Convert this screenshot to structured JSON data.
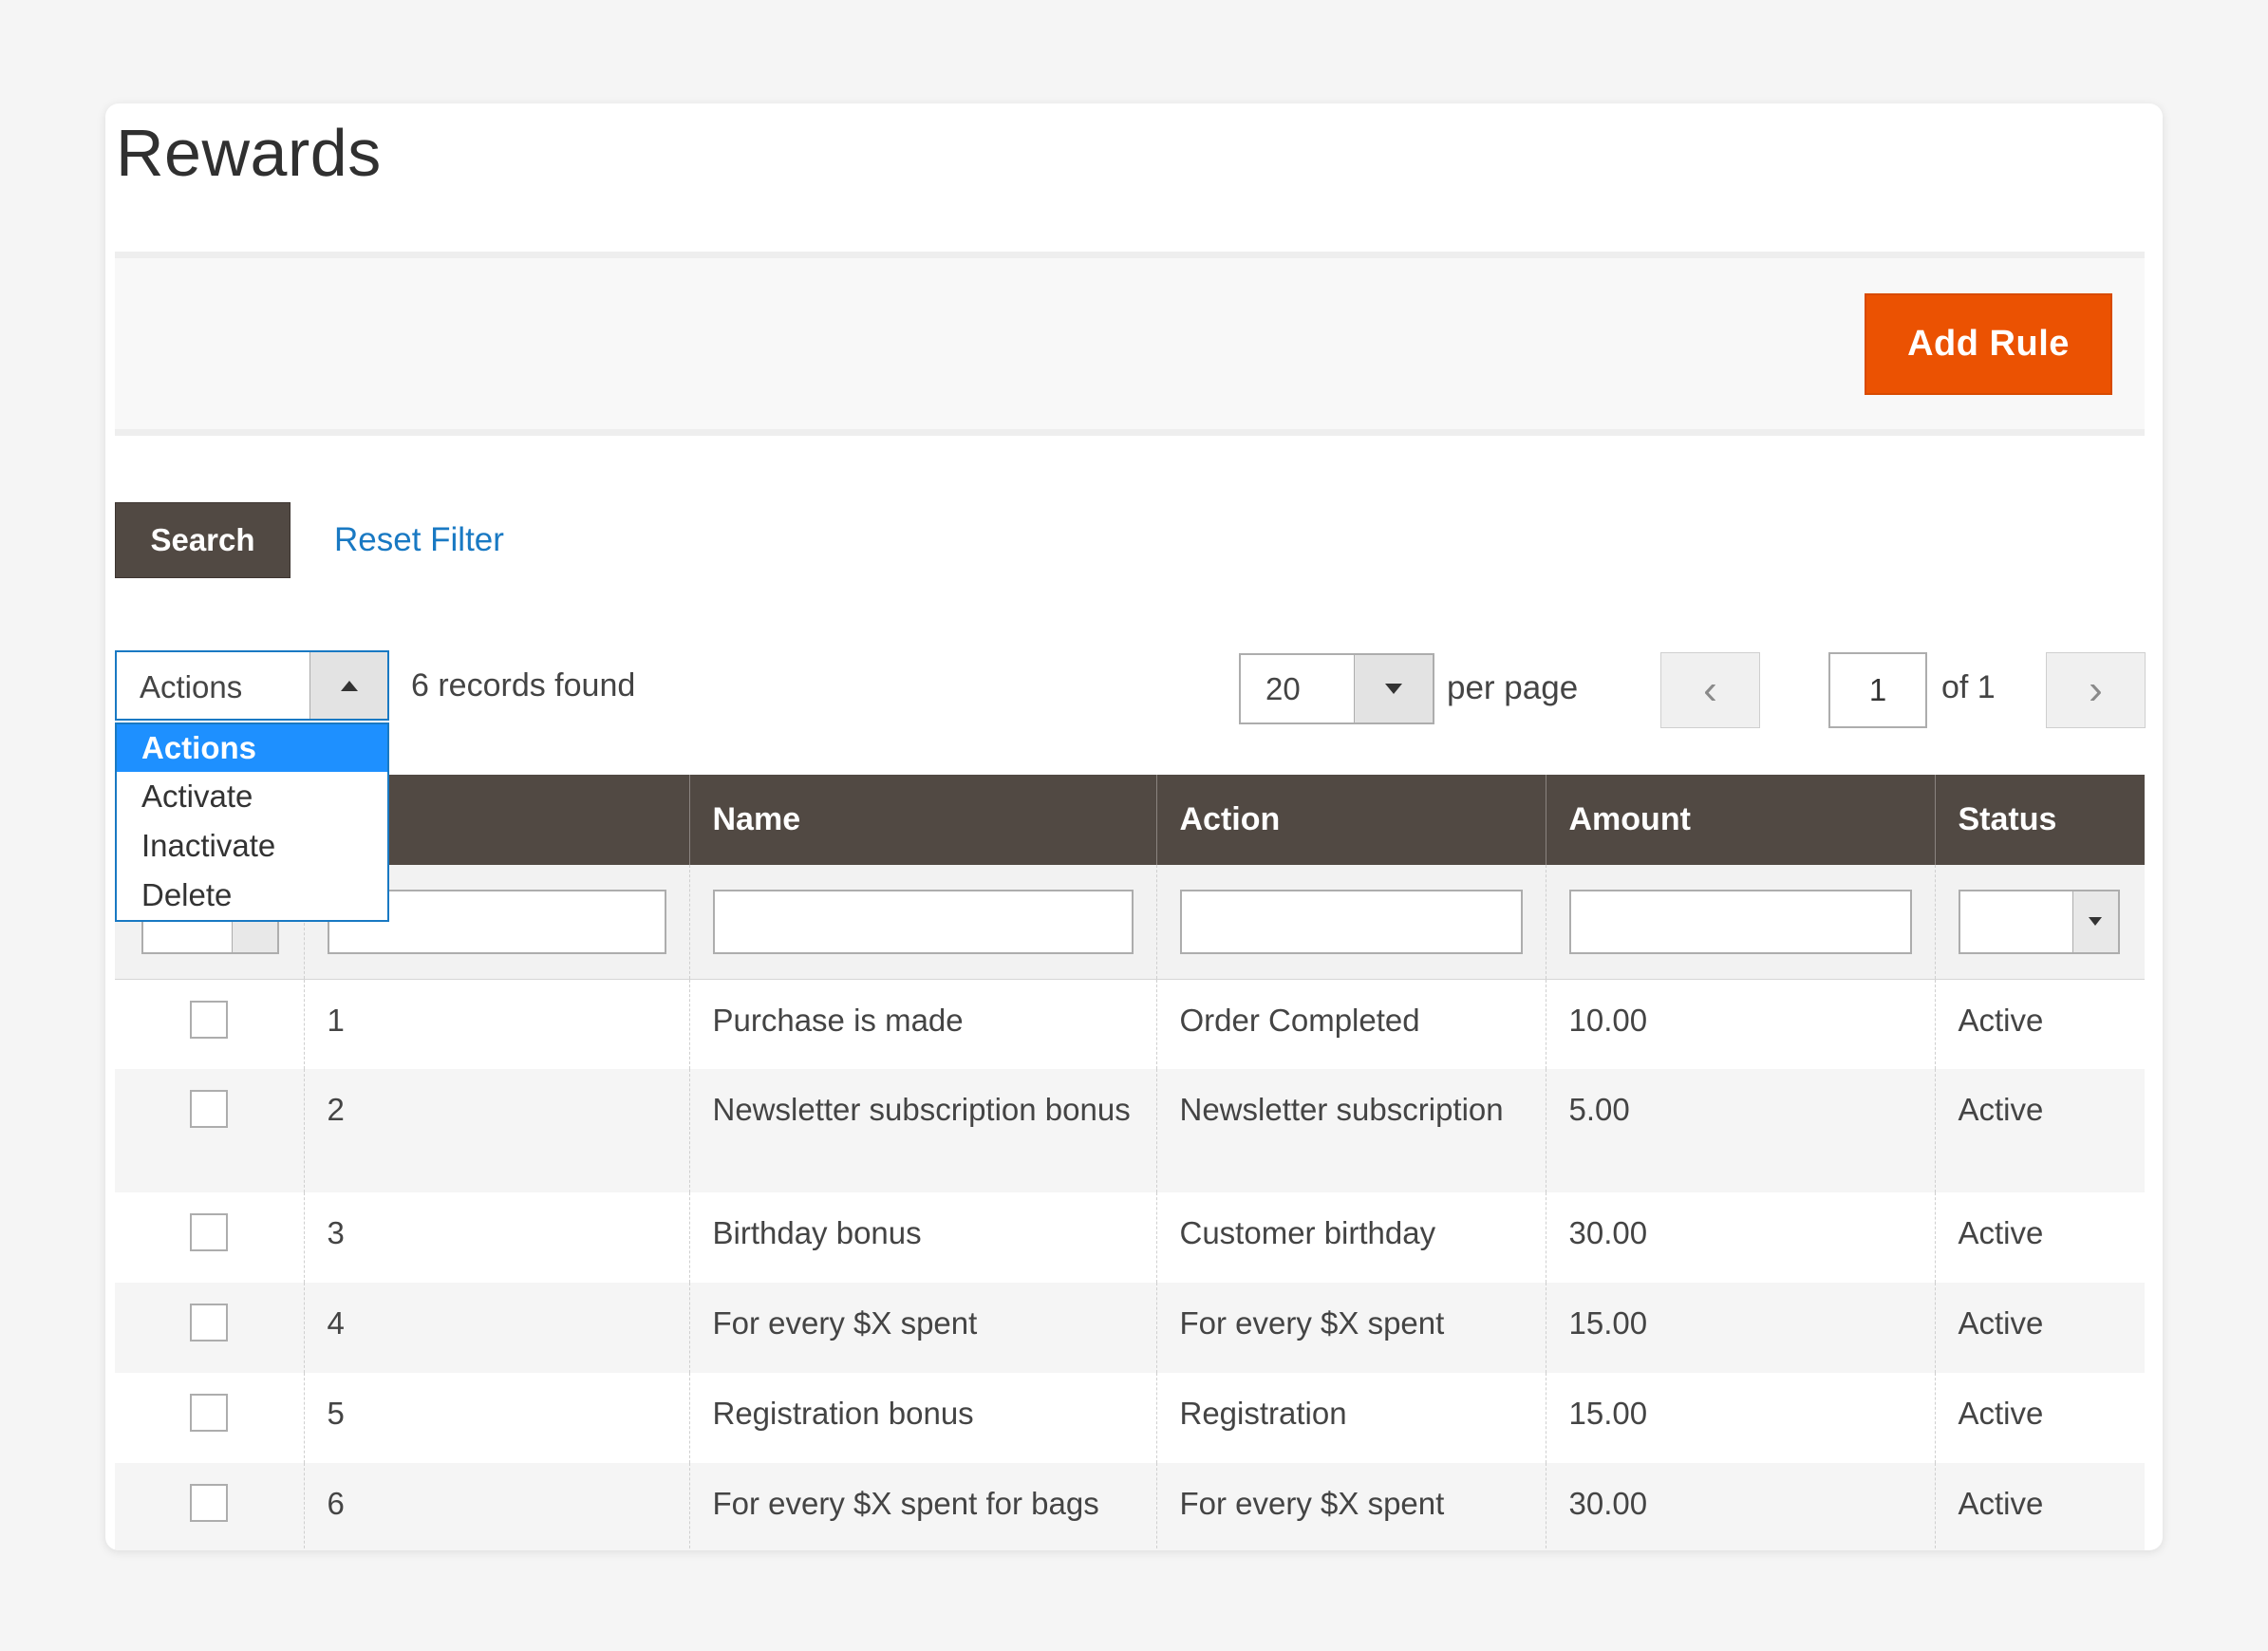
{
  "page": {
    "title": "Rewards"
  },
  "action_bar": {
    "add_rule_label": "Add Rule"
  },
  "filters": {
    "search_label": "Search",
    "reset_label": "Reset Filter"
  },
  "mass_actions": {
    "selected": "Actions",
    "options": [
      "Actions",
      "Activate",
      "Inactivate",
      "Delete"
    ]
  },
  "records_found": "6 records found",
  "pagination": {
    "per_page_value": "20",
    "per_page_label": "per page",
    "current_page": "1",
    "of_label": "of 1",
    "prev_icon": "‹",
    "next_icon": "›"
  },
  "grid": {
    "columns": [
      "",
      "",
      "Name",
      "Action",
      "Amount",
      "Status"
    ],
    "rows": [
      {
        "id": "1",
        "name": "Purchase is made",
        "action": "Order Completed",
        "amount": "10.00",
        "status": "Active"
      },
      {
        "id": "2",
        "name": "Newsletter subscription bonus",
        "action": "Newsletter subscription",
        "amount": "5.00",
        "status": "Active"
      },
      {
        "id": "3",
        "name": "Birthday bonus",
        "action": "Customer birthday",
        "amount": "30.00",
        "status": "Active"
      },
      {
        "id": "4",
        "name": "For every $X spent",
        "action": "For every $X spent",
        "amount": "15.00",
        "status": "Active"
      },
      {
        "id": "5",
        "name": "Registration bonus",
        "action": "Registration",
        "amount": "15.00",
        "status": "Active"
      },
      {
        "id": "6",
        "name": "For every $X spent for bags",
        "action": "For every $X spent",
        "amount": "30.00",
        "status": "Active"
      }
    ]
  },
  "colors": {
    "accent_orange": "#eb5202",
    "header_brown": "#514943",
    "link_blue": "#1979c3",
    "selection_blue": "#1e90ff"
  }
}
